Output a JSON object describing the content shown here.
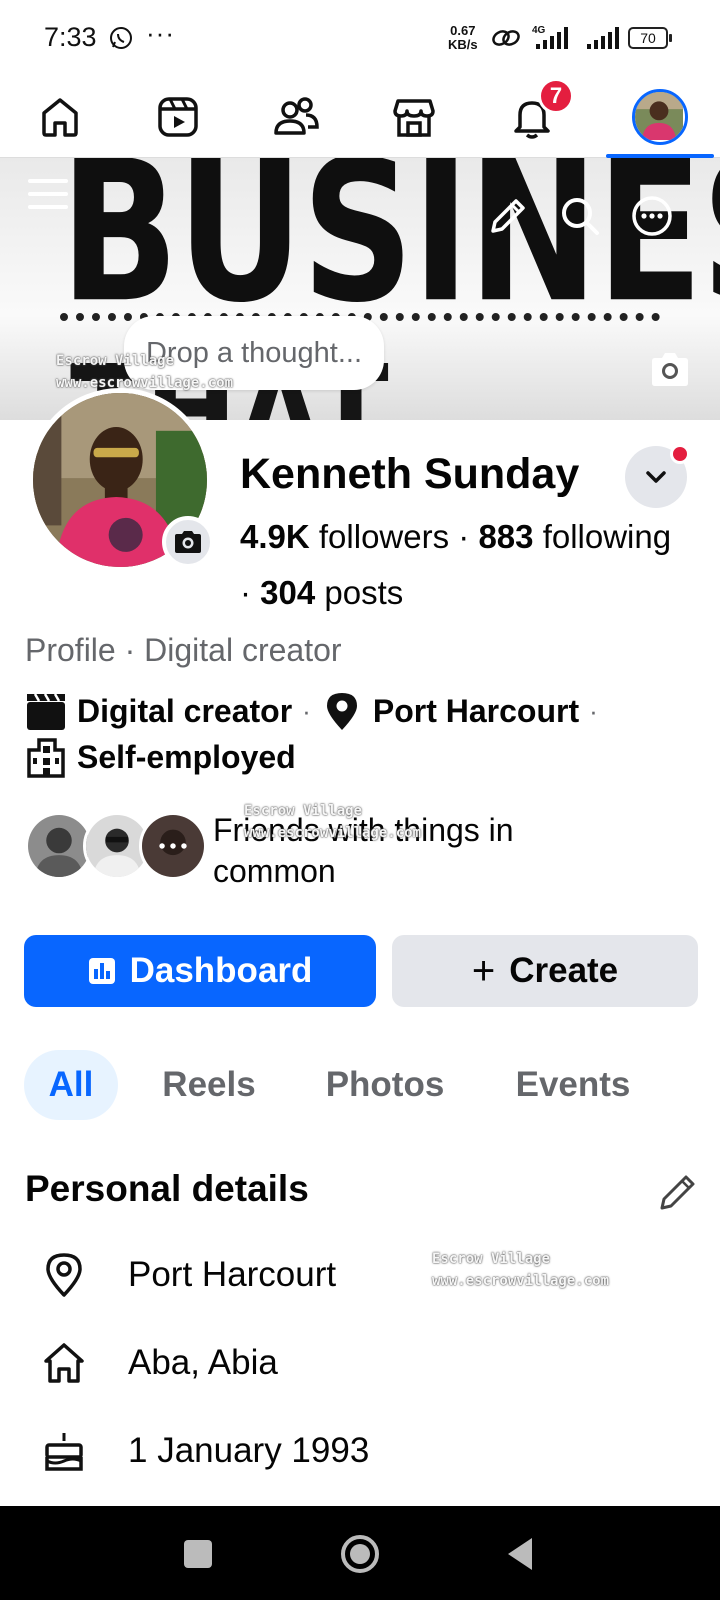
{
  "status_bar": {
    "time": "7:33",
    "dots": "···",
    "speed_value": "0.67",
    "speed_unit": "KB/s",
    "network": "4G",
    "battery": "70"
  },
  "nav": {
    "notification_count": "7",
    "items": [
      "home-icon",
      "reels-icon",
      "friends-icon",
      "marketplace-icon",
      "bell-icon",
      "profile-avatar"
    ]
  },
  "cover": {
    "text_line1": "BUSINESS",
    "text_line2": "THAT PAYS YOU",
    "thought_placeholder": "Drop a thought..."
  },
  "watermark": {
    "name": "Escrow Village",
    "url": "www.escrowvillage.com"
  },
  "profile": {
    "name": "Kenneth Sunday",
    "followers_count": "4.9K",
    "followers_label": "followers",
    "following_count": "883",
    "following_label": "following",
    "posts_count": "304",
    "posts_label": "posts",
    "separator": "·",
    "type": "Profile · Digital creator",
    "category": "Digital creator",
    "location": "Port Harcourt",
    "work": "Self-employed",
    "friends_text": "Friends with things in common"
  },
  "actions": {
    "dashboard_label": "Dashboard",
    "create_label": "Create"
  },
  "tabs": [
    "All",
    "Reels",
    "Photos",
    "Events"
  ],
  "personal_details": {
    "title": "Personal details",
    "current_city": "Port Harcourt",
    "hometown": "Aba, Abia",
    "birthday": "1 January 1993"
  },
  "colors": {
    "accent": "#0866ff",
    "badge": "#e41e3f",
    "secondary_text": "#65676b",
    "button_grey": "#e4e6eb"
  }
}
